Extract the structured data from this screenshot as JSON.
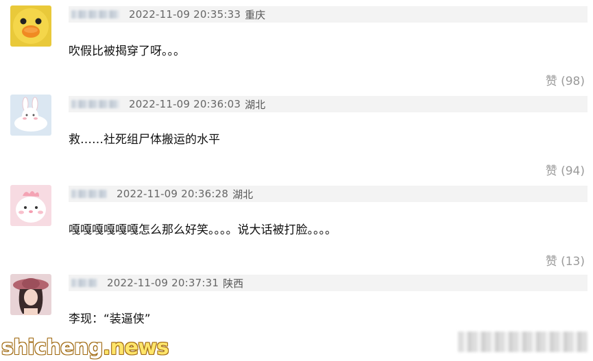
{
  "comments": [
    {
      "avatar": "yellow-duck-avatar",
      "timestamp": "2022-11-09 20:35:33",
      "location": "重庆",
      "text": "吹假比被揭穿了呀。。。",
      "like_label": "赞 (98)"
    },
    {
      "avatar": "bunny-cloud-avatar",
      "timestamp": "2022-11-09 20:36:03",
      "location": "湖北",
      "text": "救……社死组尸体搬运的水平",
      "like_label": "赞 (94)"
    },
    {
      "avatar": "pink-chick-avatar",
      "timestamp": "2022-11-09 20:36:28",
      "location": "湖北",
      "text": "嘎嘎嘎嘎嘎嘎怎么那么好笑。。。。说大话被打脸。。。。",
      "like_label": "赞 (13)"
    },
    {
      "avatar": "girl-pink-hat-avatar",
      "timestamp": "2022-11-09 20:37:31",
      "location": "陕西",
      "text": "李现：“装逼侠”",
      "like_label": ""
    }
  ],
  "watermark": {
    "prefix": "shicheng",
    "suffix": ".news"
  },
  "colors": {
    "meta_bg": "#f3f3f3",
    "like_text": "#9a9a9a"
  }
}
